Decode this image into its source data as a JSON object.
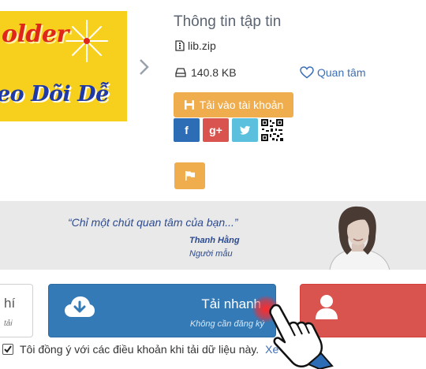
{
  "thumbnail": {
    "line1": "older",
    "line2": "eo Dõi Dễ"
  },
  "file_info": {
    "title": "Thông tin tập tin",
    "file_name": "lib.zip",
    "file_size": "140.8 KB",
    "follow_label": "Quan tâm",
    "save_label": "Tải vào tài khoản"
  },
  "share": {
    "facebook": "f",
    "google_plus": "g+",
    "twitter": "t"
  },
  "banner": {
    "quote": "“Chỉ một chút quan tâm của bạn...”",
    "name": "Thanh Hằng",
    "role": "Người mẫu"
  },
  "download": {
    "left_title": "hí",
    "left_sub": "tải",
    "fast_title": "Tải nhanh",
    "fast_sub": "Không cần đăng ký"
  },
  "agreement": {
    "checked": true,
    "text": "Tôi đồng ý với các điều khoản khi tải dữ liệu này.",
    "link": "Xe"
  },
  "colors": {
    "primary": "#337ab7",
    "warning": "#f0ad4e",
    "danger": "#d9534f",
    "facebook": "#2d6db5",
    "twitter": "#5bc0de"
  }
}
